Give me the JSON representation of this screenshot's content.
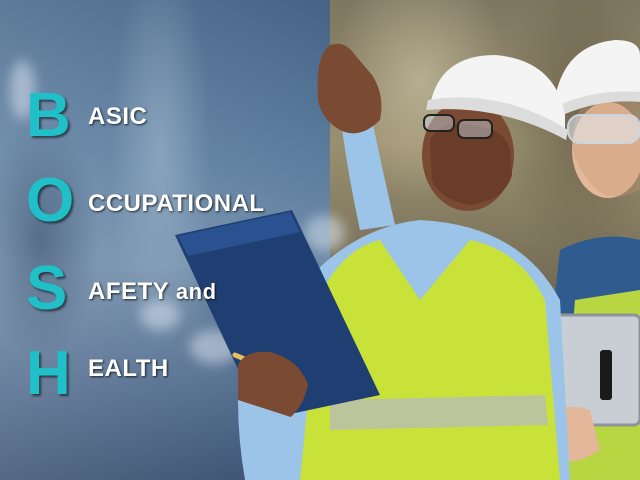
{
  "acronym": {
    "letters": [
      "B",
      "O",
      "S",
      "H"
    ],
    "words": [
      "ASIC",
      "CCUPATIONAL",
      "AFETY",
      "EALTH"
    ],
    "and_word": "and"
  },
  "colors": {
    "acronym_letter": "#20c0c8",
    "word_text": "#ffffff",
    "hard_hat": "#f4f4f4",
    "safety_vest": "#c8e23a",
    "shirt": "#9cc4e8",
    "clipboard": "#1f3f73"
  },
  "illustration": {
    "subjects": [
      "worker-man-in-hard-hat",
      "worker-woman-in-hard-hat"
    ],
    "props": [
      "clipboard",
      "pencil",
      "tablet",
      "safety-glasses"
    ]
  }
}
